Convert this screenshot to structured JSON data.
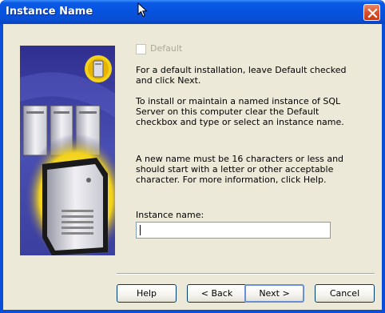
{
  "window": {
    "title": "Instance Name",
    "close_icon": "close-icon"
  },
  "options": {
    "default_checkbox_label": "Default",
    "default_checked": false,
    "default_enabled": false
  },
  "text": {
    "para1": "For a default installation, leave Default checked and click Next.",
    "para2": "To install or maintain a named instance of SQL Server on this computer clear the Default checkbox and type or select an instance name.",
    "para3": "A new name must be 16 characters or less and should start with a letter or other acceptable character.  For more information, click Help."
  },
  "instance": {
    "label": "Instance name:",
    "value": ""
  },
  "buttons": {
    "help": "Help",
    "back": "< Back",
    "next": "Next >",
    "cancel": "Cancel"
  },
  "art": {
    "icon": "server-icon",
    "colors": {
      "background": "#3a3fa0",
      "accent": "#f2d21a"
    }
  }
}
